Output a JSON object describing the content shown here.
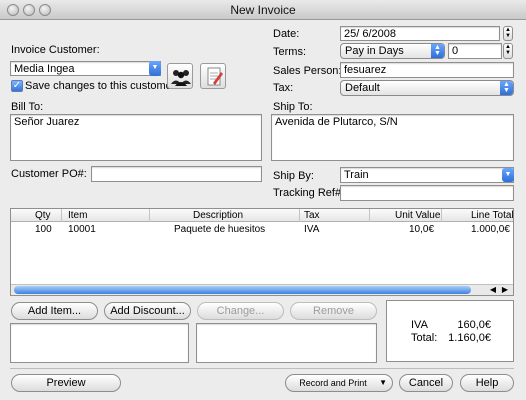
{
  "window": {
    "title": "New Invoice"
  },
  "customer": {
    "label": "Invoice Customer:",
    "value": "Media Ingea",
    "save_changes_label": "Save changes to this customer",
    "save_changes_checked": true
  },
  "date": {
    "label": "Date:",
    "value": "25/  6/2008"
  },
  "terms": {
    "label": "Terms:",
    "selected": "Pay in Days",
    "days": "0"
  },
  "sales_person": {
    "label": "Sales Person:",
    "value": "fesuarez"
  },
  "tax": {
    "label": "Tax:",
    "selected": "Default"
  },
  "bill_to": {
    "label": "Bill To:",
    "value": "Señor Juarez"
  },
  "ship_to": {
    "label": "Ship To:",
    "value": "Avenida de Plutarco, S/N"
  },
  "customer_po": {
    "label": "Customer PO#:",
    "value": ""
  },
  "ship_by": {
    "label": "Ship By:",
    "selected": "Train"
  },
  "tracking": {
    "label": "Tracking Ref#:",
    "value": ""
  },
  "items_table": {
    "columns": [
      "Qty",
      "Item",
      "Description",
      "Tax",
      "Unit Value",
      "Line Total"
    ],
    "rows": [
      [
        "100",
        "10001",
        "Paquete de huesitos",
        "IVA",
        "10,0€",
        "1.000,0€"
      ]
    ]
  },
  "item_buttons": {
    "add_item": "Add Item...",
    "add_discount": "Add Discount...",
    "change": "Change...",
    "remove": "Remove"
  },
  "totals": {
    "tax_name": "IVA",
    "tax_value": "160,0€",
    "total_label": "Total:",
    "total_value": "1.160,0€"
  },
  "bottom_buttons": {
    "preview": "Preview",
    "record_and_print": "Record and Print",
    "cancel": "Cancel",
    "help": "Help"
  },
  "icons": {
    "customers": "people-icon",
    "edit": "edit-document-icon",
    "close": "close-window-icon",
    "minimize": "minimize-window-icon",
    "zoom": "zoom-window-icon",
    "date_stepper": "stepper-icon",
    "popup": "chevron-up-down-icon",
    "scroll_left": "scroll-left-icon",
    "scroll_right": "scroll-right-icon"
  },
  "colors": {
    "accent": "#3574d8",
    "window_bg": "#ececec"
  }
}
